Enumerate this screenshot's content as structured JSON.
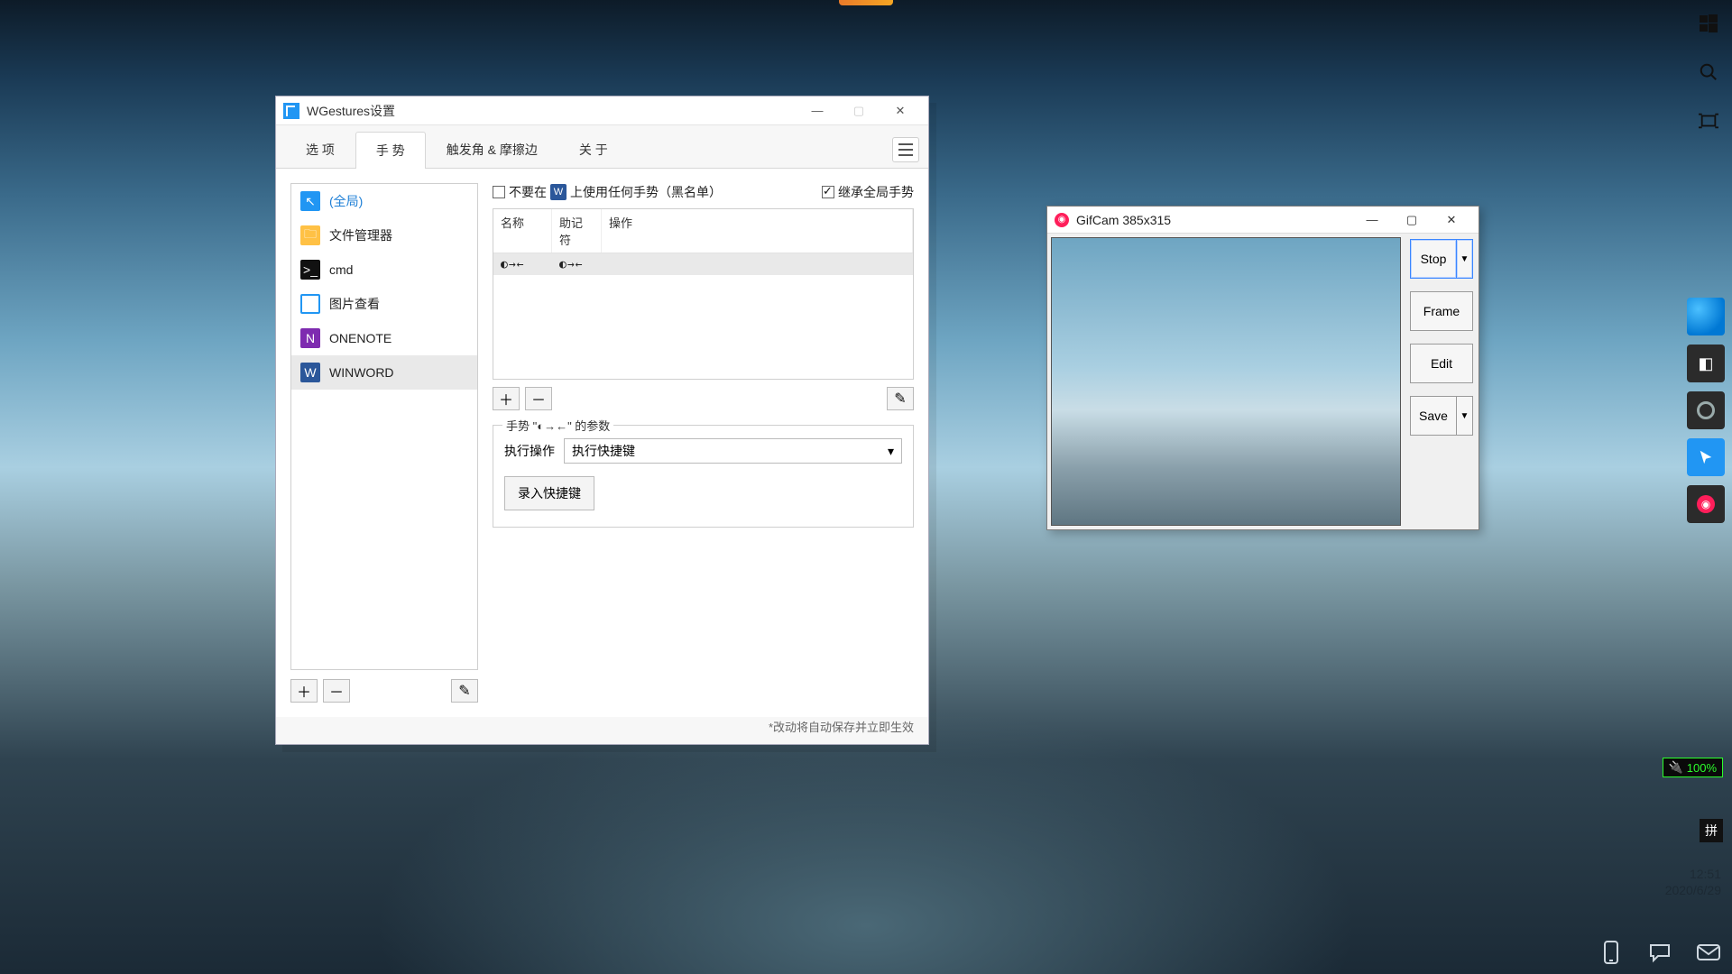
{
  "wg": {
    "title": "WGestures设置",
    "tabs": {
      "options": "选 项",
      "gestures": "手 势",
      "triggers": "触发角 & 摩擦边",
      "about": "关 于"
    },
    "apps": [
      {
        "label": "(全局)",
        "icon": "cur",
        "global": true
      },
      {
        "label": "文件管理器",
        "icon": "folder"
      },
      {
        "label": "cmd",
        "icon": "term"
      },
      {
        "label": "图片查看",
        "icon": "img"
      },
      {
        "label": "ONENOTE",
        "icon": "on"
      },
      {
        "label": "WINWORD",
        "icon": "word",
        "selected": true
      }
    ],
    "opt_noUse_prefix": "不要在",
    "opt_noUse_appIcon": "word",
    "opt_noUse_suffix": "上使用任何手势（黑名单）",
    "opt_inherit": "继承全局手势",
    "table": {
      "headers": {
        "name": "名称",
        "mnemonic": "助记符",
        "action": "操作"
      },
      "rows": [
        {
          "name": "◐→←",
          "mnemonic": "◐→←",
          "action": "",
          "selected": true
        }
      ]
    },
    "params": {
      "legend": "手势 \"◐→←\" 的参数",
      "actionLabel": "执行操作",
      "actionValue": "执行快捷键",
      "recordBtn": "录入快捷键"
    },
    "footer": "*改动将自动保存并立即生效"
  },
  "gc": {
    "title": "GifCam 385x315",
    "buttons": {
      "stop": "Stop",
      "frame": "Frame",
      "edit": "Edit",
      "save": "Save"
    }
  },
  "system": {
    "battery": "100%",
    "ime": "拼",
    "time": "12:51",
    "date": "2020/6/29"
  }
}
